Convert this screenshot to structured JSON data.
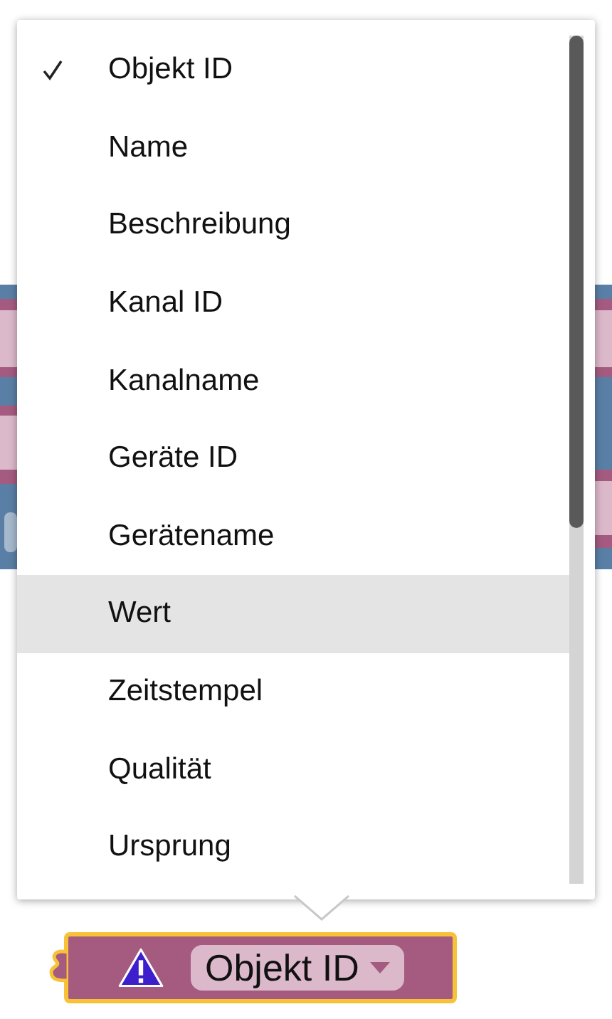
{
  "menu": {
    "items": [
      {
        "label": "Objekt ID",
        "checked": true,
        "highlighted": false
      },
      {
        "label": "Name",
        "checked": false,
        "highlighted": false
      },
      {
        "label": "Beschreibung",
        "checked": false,
        "highlighted": false
      },
      {
        "label": "Kanal ID",
        "checked": false,
        "highlighted": false
      },
      {
        "label": "Kanalname",
        "checked": false,
        "highlighted": false
      },
      {
        "label": "Geräte ID",
        "checked": false,
        "highlighted": false
      },
      {
        "label": "Gerätename",
        "checked": false,
        "highlighted": false
      },
      {
        "label": "Wert",
        "checked": false,
        "highlighted": true
      },
      {
        "label": "Zeitstempel",
        "checked": false,
        "highlighted": false
      },
      {
        "label": "Qualität",
        "checked": false,
        "highlighted": false
      },
      {
        "label": "Ursprung",
        "checked": false,
        "highlighted": false
      }
    ]
  },
  "block": {
    "dropdown": {
      "value": "Objekt ID"
    }
  }
}
